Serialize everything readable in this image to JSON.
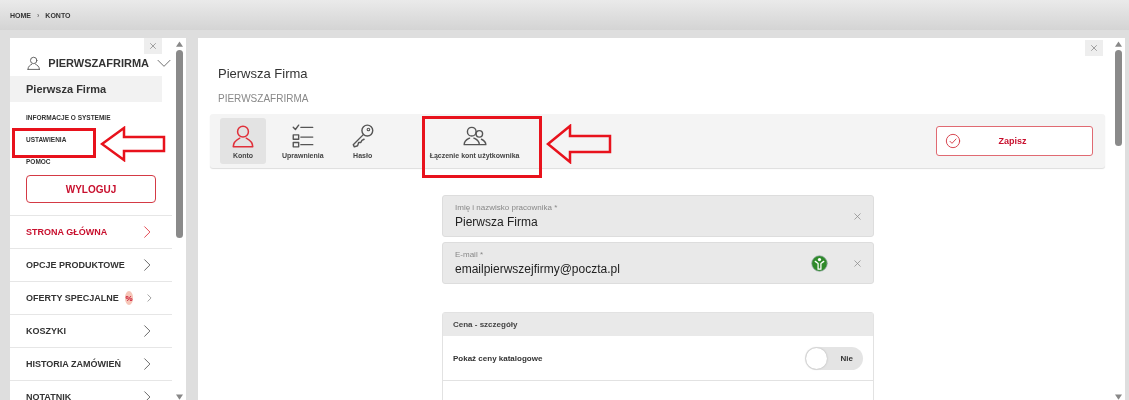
{
  "breadcrumb": {
    "items": [
      "HOME",
      "KONTO"
    ],
    "separator": "›"
  },
  "sidebar": {
    "username": "PIERWSZAFRIRMA",
    "company": "Pierwsza Firma",
    "links": [
      "INFORMACJE O SYSTEMIE",
      "USTAWIENIA",
      "POMOC"
    ],
    "logout_button": "WYLOGUJ",
    "nav": [
      {
        "label": "STRONA GŁÓWNA",
        "selected": true
      },
      {
        "label": "OPCJE PRODUKTOWE",
        "selected": false
      },
      {
        "label": "OFERTY SPECJALNE",
        "selected": false,
        "badge": "%"
      },
      {
        "label": "KOSZYKI",
        "selected": false
      },
      {
        "label": "HISTORIA ZAMÓWIEŃ",
        "selected": false
      },
      {
        "label": "NOTATNIK",
        "selected": false
      }
    ]
  },
  "main": {
    "title": "Pierwsza Firma",
    "subtitle": "PIERWSZAFRIRMA",
    "tabs": [
      {
        "label": "Konto",
        "selected": true
      },
      {
        "label": "Uprawnienia",
        "selected": false
      },
      {
        "label": "Hasło",
        "selected": false
      },
      {
        "label": "Łączenie kont użytkownika",
        "selected": false
      }
    ],
    "save_button": "Zapisz",
    "fields": [
      {
        "label": "Imię i nazwisko pracownika *",
        "value": "Pierwsza Firma",
        "verified": false
      },
      {
        "label": "E-mail *",
        "value": "emailpierwszejfirmy@poczta.pl",
        "verified": true
      }
    ],
    "section": {
      "title": "Cena - szczegóły",
      "rows": [
        {
          "label": "Pokaż ceny katalogowe",
          "on": false,
          "state": "Nie"
        }
      ]
    }
  }
}
